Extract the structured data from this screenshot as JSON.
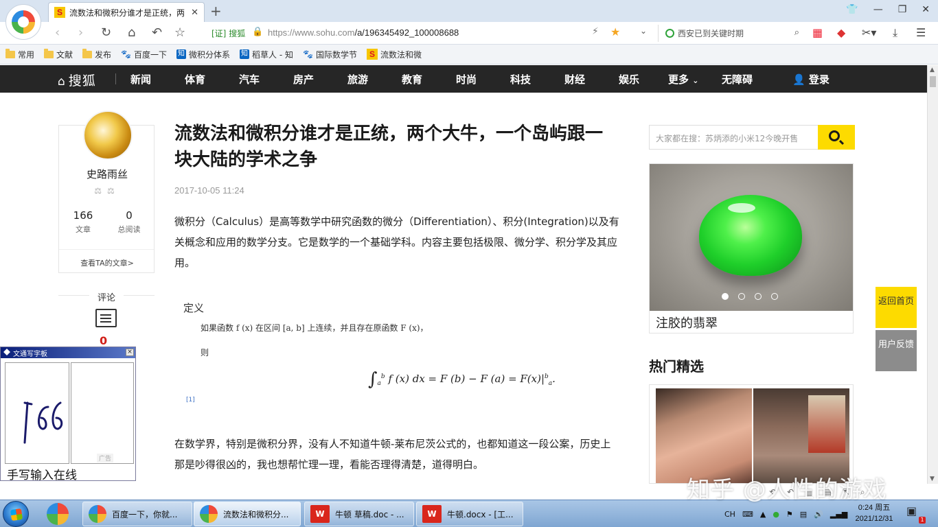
{
  "browser": {
    "tab_title": "流数法和微积分谁才是正统，两",
    "url_host": "https://www.sohu.com",
    "url_path": "/a/196345492_100008688",
    "cert_label": "搜狐",
    "search_text": "西安已到关键时期"
  },
  "bookmarks": [
    {
      "label": "常用",
      "icon": "folder-icon"
    },
    {
      "label": "文献",
      "icon": "folder-icon"
    },
    {
      "label": "发布",
      "icon": "folder-icon"
    },
    {
      "label": "百度一下",
      "icon": "baidu-paw-icon"
    },
    {
      "label": "微积分体系",
      "icon": "zhihu-icon"
    },
    {
      "label": "稻草人 - 知",
      "icon": "zhihu-icon"
    },
    {
      "label": "国际数学节",
      "icon": "baidu-paw-icon"
    },
    {
      "label": "流数法和微",
      "icon": "sohu-icon"
    }
  ],
  "sohu_nav": {
    "logo": "搜狐",
    "items": [
      "新闻",
      "体育",
      "汽车",
      "房产",
      "旅游",
      "教育",
      "时尚",
      "科技",
      "财经",
      "娱乐",
      "更多",
      "无障碍"
    ],
    "login": "登录"
  },
  "author": {
    "name": "史路雨丝",
    "badges": "⚖⚖",
    "articles_count": "166",
    "articles_label": "文章",
    "reads_count": "0",
    "reads_label": "总阅读",
    "view_link": "查看TA的文章>"
  },
  "comments": {
    "label": "评论",
    "count": "0"
  },
  "article": {
    "title": "流数法和微积分谁才是正统，两个大牛，一个岛屿跟一块大陆的学术之争",
    "date": "2017-10-05 11:24",
    "para1": "微积分（Calculus）是高等数学中研究函数的微分（Differentiation）、积分(Integration)以及有关概念和应用的数学分支。它是数学的一个基础学科。内容主要包括极限、微分学、积分学及其应用。",
    "definition": {
      "title": "定义",
      "line1": "如果函数 f (x) 在区间 [a, b] 上连续，并且存在原函数 F (x)，",
      "then": "则",
      "formula_rhs": "f (x) dx = F (b) − F (a) = F(x)|",
      "upper": "b",
      "lower": "a",
      "footnote": "[1]"
    },
    "para2": "在数学界，特别是微积分界，没有人不知道牛顿-莱布尼茨公式的，也都知道这一段公案，历史上那是吵得很凶的，我也想帮忙理一理，看能否理得清楚，道得明白。"
  },
  "sidebar": {
    "search_placeholder": "大家都在搜：苏炳添的小米12今晚开售",
    "ad_caption": "注胶的翡翠",
    "hot_title": "热门精选",
    "back_top": "返回首页",
    "feedback": "用户反馈"
  },
  "handwriting": {
    "title": "文通写字板",
    "ad": "广告",
    "input_label": "手写输入在线"
  },
  "taskbar": {
    "tasks": [
      "百度一下，你就...",
      "流数法和微积分...",
      "牛顿 草稿.doc - ...",
      "牛顿.docx - [工..."
    ],
    "ime": "CH",
    "time": "0:24 周五",
    "date": "2021/12/31",
    "notif_count": "1"
  },
  "watermark": "知乎 @人性的游戏"
}
